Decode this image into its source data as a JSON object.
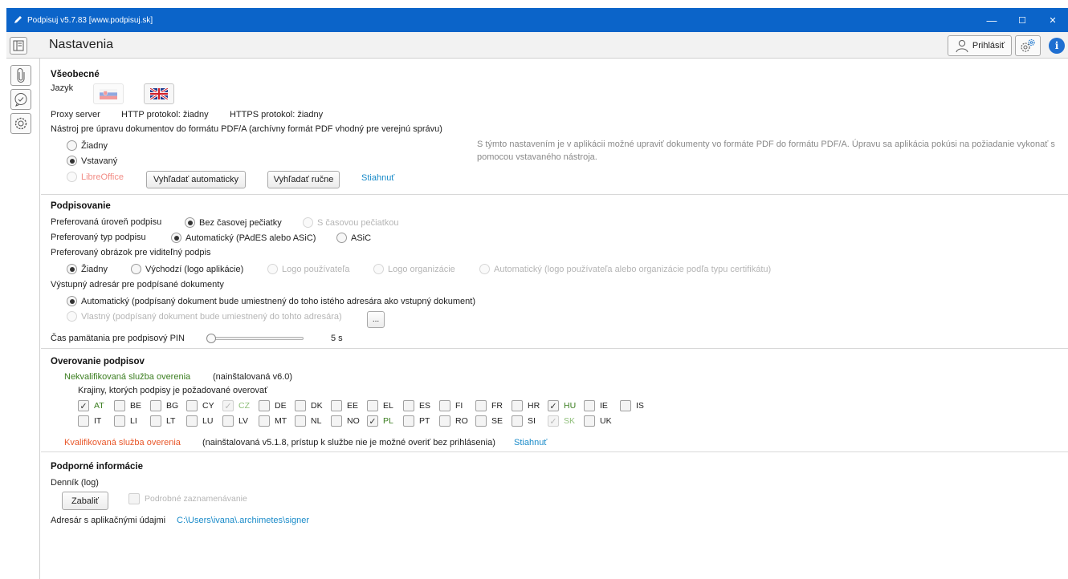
{
  "window": {
    "title": "Podpisuj v5.7.83 [www.podpisuj.sk]",
    "minimize": "—",
    "maximize": "☐",
    "close": "✕"
  },
  "header": {
    "title": "Nastavenia",
    "login_label": "Prihlásiť"
  },
  "colors": {
    "titlebar": "#0b64c9",
    "link": "#1a8bc9",
    "green": "#3a7d1f",
    "red": "#e8572a"
  },
  "general": {
    "heading": "Všeobecné",
    "language_label": "Jazyk",
    "proxy_label": "Proxy server",
    "http_proxy": "HTTP protokol: žiadny",
    "https_proxy": "HTTPS protokol: žiadny",
    "pdfa_label": "Nástroj pre úpravu dokumentov do formátu PDF/A (archívny formát PDF vhodný pre verejnú správu)",
    "pdfa_options": [
      "Žiadny",
      "Vstavaný",
      "LibreOffice"
    ],
    "pdfa_selected": "Vstavaný",
    "search_auto": "Vyhľadať automaticky",
    "search_manual": "Vyhľadať ručne",
    "download": "Stiahnuť",
    "pdfa_info_line1": "S týmto nastavením je v aplikácii možné upraviť dokumenty vo formáte PDF do formátu PDF/A. Úpravu sa aplikácia pokúsi na požiadanie vykonať s",
    "pdfa_info_line2": "pomocou vstavaného nástroja."
  },
  "signing": {
    "heading": "Podpisovanie",
    "level_label": "Preferovaná úroveň podpisu",
    "level_options": [
      "Bez časovej pečiatky",
      "S časovou pečiatkou"
    ],
    "type_label": "Preferovaný typ podpisu",
    "type_options": [
      "Automatický (PAdES alebo ASiC)",
      "ASiC"
    ],
    "image_label": "Preferovaný obrázok pre viditeľný podpis",
    "image_options": [
      "Žiadny",
      "Východzí (logo aplikácie)",
      "Logo používateľa",
      "Logo organizácie",
      "Automatický (logo používateľa alebo organizácie podľa typu certifikátu)"
    ],
    "output_label": "Výstupný adresár pre podpísané dokumenty",
    "output_auto": "Automatický (podpísaný dokument bude umiestnený do toho istého adresára ako vstupný dokument)",
    "output_custom": "Vlastný (podpísaný dokument bude umiestnený do tohto adresára)",
    "browse": "...",
    "pin_label": "Čas pamätania pre podpisový PIN",
    "pin_value": "5 s",
    "pin_fraction": 0.0
  },
  "verification": {
    "heading": "Overovanie podpisov",
    "unqualified_label": "Nekvalifikovaná služba overenia",
    "unqualified_status": "(nainštalovaná v6.0)",
    "countries_label": "Krajiny, ktorých podpisy je požadované overovať",
    "row1": [
      {
        "code": "AT",
        "checked": true,
        "disabled": false
      },
      {
        "code": "BE",
        "checked": false,
        "disabled": false
      },
      {
        "code": "BG",
        "checked": false,
        "disabled": false
      },
      {
        "code": "CY",
        "checked": false,
        "disabled": false
      },
      {
        "code": "CZ",
        "checked": true,
        "disabled": true
      },
      {
        "code": "DE",
        "checked": false,
        "disabled": false
      },
      {
        "code": "DK",
        "checked": false,
        "disabled": false
      },
      {
        "code": "EE",
        "checked": false,
        "disabled": false
      },
      {
        "code": "EL",
        "checked": false,
        "disabled": false
      },
      {
        "code": "ES",
        "checked": false,
        "disabled": false
      },
      {
        "code": "FI",
        "checked": false,
        "disabled": false
      },
      {
        "code": "FR",
        "checked": false,
        "disabled": false
      },
      {
        "code": "HR",
        "checked": false,
        "disabled": false
      },
      {
        "code": "HU",
        "checked": true,
        "disabled": false
      },
      {
        "code": "IE",
        "checked": false,
        "disabled": false
      },
      {
        "code": "IS",
        "checked": false,
        "disabled": false
      }
    ],
    "row2": [
      {
        "code": "IT",
        "checked": false,
        "disabled": false
      },
      {
        "code": "LI",
        "checked": false,
        "disabled": false
      },
      {
        "code": "LT",
        "checked": false,
        "disabled": false
      },
      {
        "code": "LU",
        "checked": false,
        "disabled": false
      },
      {
        "code": "LV",
        "checked": false,
        "disabled": false
      },
      {
        "code": "MT",
        "checked": false,
        "disabled": false
      },
      {
        "code": "NL",
        "checked": false,
        "disabled": false
      },
      {
        "code": "NO",
        "checked": false,
        "disabled": false
      },
      {
        "code": "PL",
        "checked": true,
        "disabled": false
      },
      {
        "code": "PT",
        "checked": false,
        "disabled": false
      },
      {
        "code": "RO",
        "checked": false,
        "disabled": false
      },
      {
        "code": "SE",
        "checked": false,
        "disabled": false
      },
      {
        "code": "SI",
        "checked": false,
        "disabled": false
      },
      {
        "code": "SK",
        "checked": true,
        "disabled": true
      },
      {
        "code": "UK",
        "checked": false,
        "disabled": false
      }
    ],
    "qualified_label": "Kvalifikovaná služba overenia",
    "qualified_status": "(nainštalovaná v5.1.8, prístup k službe nie je možné overiť bez prihlásenia)",
    "download": "Stiahnuť"
  },
  "support": {
    "heading": "Podporné informácie",
    "log_label": "Denník (log)",
    "pack_button": "Zabaliť",
    "verbose_label": "Podrobné zaznamenávanie",
    "appdata_label": "Adresár s aplikačnými údajmi",
    "appdata_path": "C:\\Users\\ivana\\.archimetes\\signer"
  }
}
